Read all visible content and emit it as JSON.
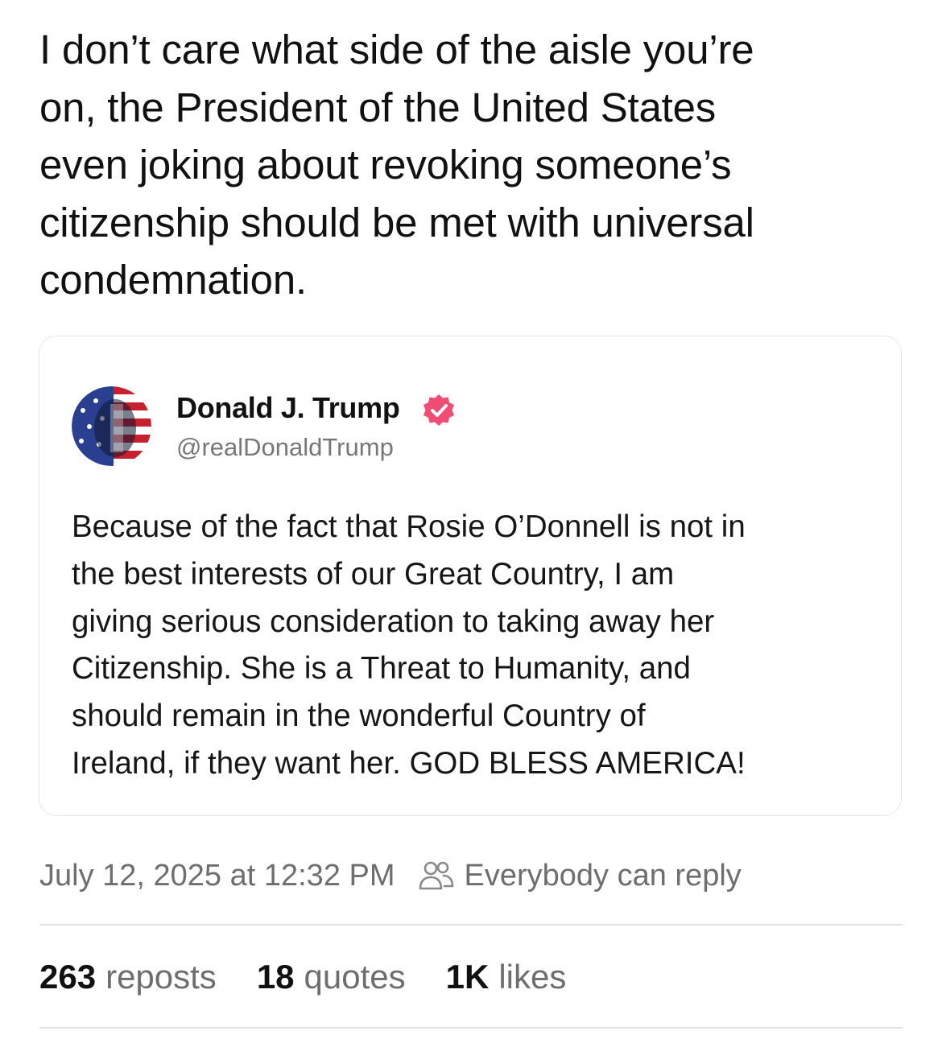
{
  "post": {
    "text": "I don’t care what side of the aisle you’re\non, the President of the United States\neven joking about revoking someone’s\ncitizenship should be met with universal\ncondemnation."
  },
  "quoted_post": {
    "author_name": "Donald J. Trump",
    "author_handle": "@realDonaldTrump",
    "verified_badge_icon": "verified-badge-icon",
    "verified_badge_color": "#f04d74",
    "text": "Because of the fact that Rosie O’Donnell is not in\nthe best interests of our Great Country, I am\ngiving serious consideration to taking away her\nCitizenship. She is a Threat to Humanity, and\nshould remain in the wonderful Country of\nIreland, if they want her. GOD BLESS AMERICA!"
  },
  "meta": {
    "timestamp": "July 12, 2025 at 12:32 PM",
    "reply_setting_icon": "people-icon",
    "reply_setting": "Everybody can reply"
  },
  "stats": [
    {
      "count": "263",
      "label": "reposts"
    },
    {
      "count": "18",
      "label": "quotes"
    },
    {
      "count": "1K",
      "label": "likes"
    }
  ]
}
